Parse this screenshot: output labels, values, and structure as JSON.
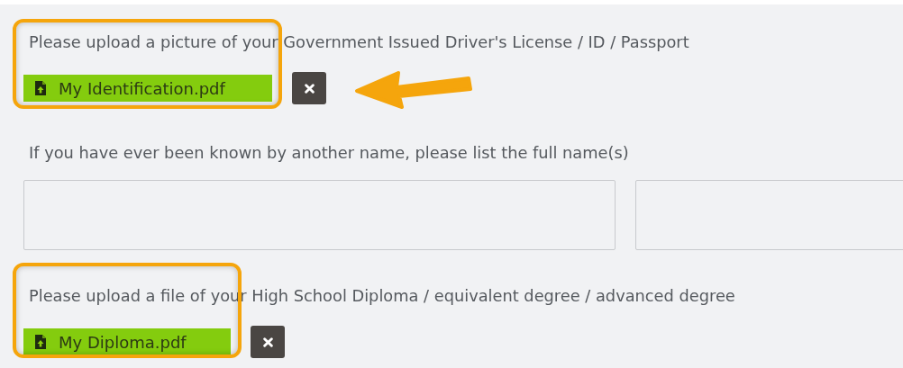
{
  "sections": [
    {
      "kind": "upload",
      "label": "Please upload a picture of your Government Issued Driver's License / ID / Passport",
      "file_name": "My Identification.pdf",
      "highlighted": true,
      "arrow": true
    },
    {
      "kind": "names",
      "label": "If you have ever been known by another name, please list the full name(s)",
      "inputs": [
        {
          "kind": "text"
        },
        {
          "kind": "text"
        }
      ]
    },
    {
      "kind": "upload",
      "label": "Please upload a file of your High School Diploma / equivalent degree / advanced degree",
      "file_name": "My Diploma.pdf",
      "highlighted": true
    }
  ]
}
